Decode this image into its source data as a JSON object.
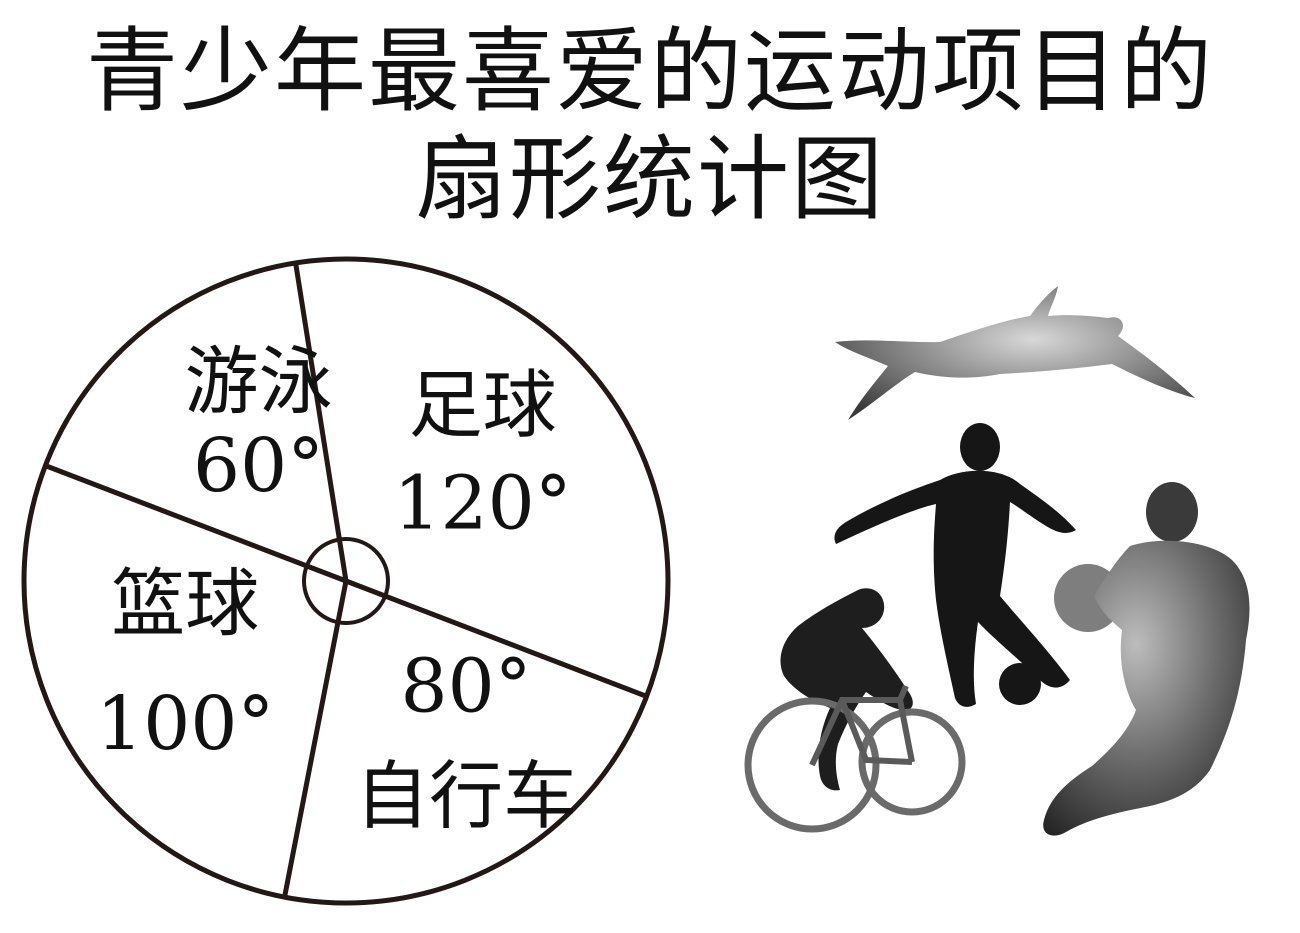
{
  "title_line1": "青少年最喜爱的运动项目的",
  "title_line2": "扇形统计图",
  "chart_data": {
    "type": "pie",
    "title": "青少年最喜爱的运动项目的扇形统计图",
    "unit": "°",
    "slices": [
      {
        "name": "足球",
        "value": 120,
        "label": "120°"
      },
      {
        "name": "自行车",
        "value": 80,
        "label": "80°"
      },
      {
        "name": "篮球",
        "value": 100,
        "label": "100°"
      },
      {
        "name": "游泳",
        "value": 60,
        "label": "60°"
      }
    ]
  },
  "colors": {
    "stroke": "#231815",
    "fill": "#ffffff",
    "text": "#111111",
    "silhouette": "#1a1a1a"
  },
  "icons": [
    "swimmer-icon",
    "soccer-player-icon",
    "basketball-player-icon",
    "cyclist-icon"
  ]
}
